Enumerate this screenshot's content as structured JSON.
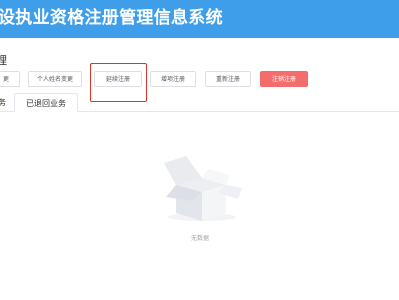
{
  "header": {
    "title": "设执业资格注册管理信息系统"
  },
  "section": {
    "title": "理"
  },
  "toolbar": {
    "buttons": [
      {
        "label": "更"
      },
      {
        "label": "个人姓名变更"
      },
      {
        "label": "延续注册"
      },
      {
        "label": "增项注册"
      },
      {
        "label": "重新注册"
      },
      {
        "label": "注销注册"
      }
    ]
  },
  "tabs": [
    {
      "label": "务"
    },
    {
      "label": "已退回业务"
    }
  ],
  "empty": {
    "text": "无数据",
    "icon": "empty-box-icon"
  },
  "colors": {
    "header": "#3f9eea",
    "danger": "#f56c6c",
    "highlight": "#e0302a"
  }
}
